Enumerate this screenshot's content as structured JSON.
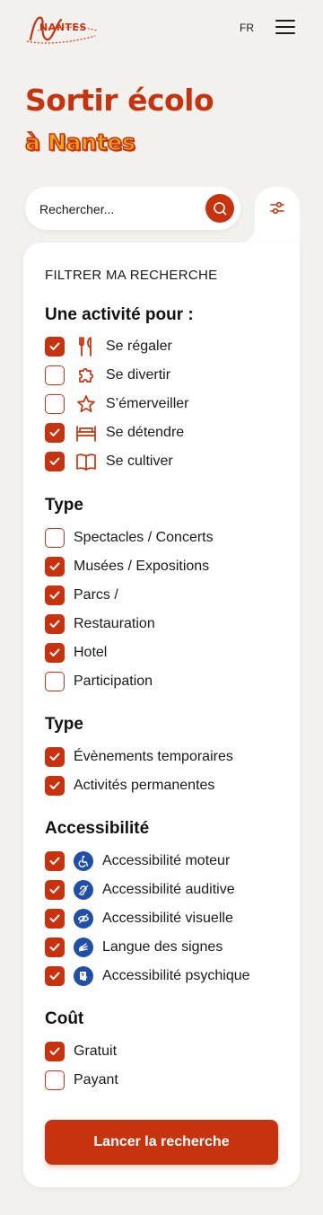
{
  "header": {
    "logo_text": "NANTES",
    "lang": "FR"
  },
  "hero": {
    "line1": "Sortir écolo",
    "line2": "à Nantes"
  },
  "search": {
    "placeholder": "Rechercher..."
  },
  "filters": {
    "title": "FILTRER MA RECHERCHE",
    "sections": [
      {
        "title": "Une activité pour :",
        "options": [
          {
            "label": "Se régaler",
            "checked": true,
            "icon": "fork-knife-icon"
          },
          {
            "label": "Se divertir",
            "checked": false,
            "icon": "puzzle-icon"
          },
          {
            "label": "S’émerveiller",
            "checked": false,
            "icon": "star-icon"
          },
          {
            "label": "Se détendre",
            "checked": true,
            "icon": "bed-icon"
          },
          {
            "label": "Se cultiver",
            "checked": true,
            "icon": "book-icon"
          }
        ]
      },
      {
        "title": "Type",
        "options": [
          {
            "label": "Spectacles / Concerts",
            "checked": false
          },
          {
            "label": "Musées / Expositions",
            "checked": true
          },
          {
            "label": "Parcs /",
            "checked": true
          },
          {
            "label": "Restauration",
            "checked": true
          },
          {
            "label": "Hotel",
            "checked": true
          },
          {
            "label": "Participation",
            "checked": false
          }
        ]
      },
      {
        "title": "Type",
        "options": [
          {
            "label": "Évènements temporaires",
            "checked": true
          },
          {
            "label": "Activités permanentes",
            "checked": true
          }
        ]
      },
      {
        "title": "Accessibilité",
        "options": [
          {
            "label": "Accessibilité moteur",
            "checked": true,
            "icon": "wheelchair-icon"
          },
          {
            "label": "Accessibilité auditive",
            "checked": true,
            "icon": "ear-icon"
          },
          {
            "label": "Accessibilité visuelle",
            "checked": true,
            "icon": "eye-slash-icon"
          },
          {
            "label": "Langue des signes",
            "checked": true,
            "icon": "sign-language-icon"
          },
          {
            "label": "Accessibilité psychique",
            "checked": true,
            "icon": "head-icon"
          }
        ]
      },
      {
        "title": "Coût",
        "options": [
          {
            "label": "Gratuit",
            "checked": true
          },
          {
            "label": "Payant",
            "checked": false
          }
        ]
      }
    ],
    "submit_label": "Lancer la recherche"
  },
  "colors": {
    "accent": "#c8330f",
    "accessibility": "#1f4fa8",
    "background": "#f3f1ed"
  }
}
